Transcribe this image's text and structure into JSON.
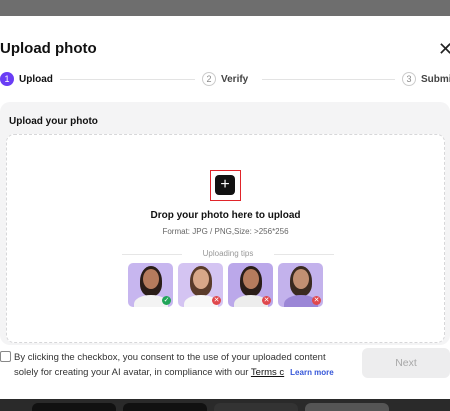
{
  "dialog": {
    "title": "Upload photo",
    "close_icon": "close-icon"
  },
  "steps": [
    {
      "num": "1",
      "label": "Upload",
      "state": "active"
    },
    {
      "num": "2",
      "label": "Verify",
      "state": "inactive"
    },
    {
      "num": "3",
      "label": "Submi",
      "state": "inactive"
    }
  ],
  "upload": {
    "section_title": "Upload your photo",
    "plus_icon": "plus-icon",
    "drop_title": "Drop your photo here to upload",
    "format_text": "Format: JPG / PNG,Size: >256*256",
    "tips_label": "Uploading tips",
    "tips": [
      {
        "status": "good",
        "badge": "check-icon"
      },
      {
        "status": "bad",
        "badge": "x-icon"
      },
      {
        "status": "bad",
        "badge": "x-icon"
      },
      {
        "status": "bad",
        "badge": "x-icon"
      }
    ]
  },
  "consent": {
    "text_before": "By clicking the checkbox, you consent to the use of your uploaded content solely for creating your AI avatar, in compliance with our ",
    "terms_link": "Terms c",
    "learn_more": "Learn more"
  },
  "actions": {
    "next_label": "Next"
  },
  "colors": {
    "accent": "#6a3df5",
    "ok": "#22a55a",
    "bad": "#e0484d",
    "highlight_frame": "#e0242a"
  }
}
